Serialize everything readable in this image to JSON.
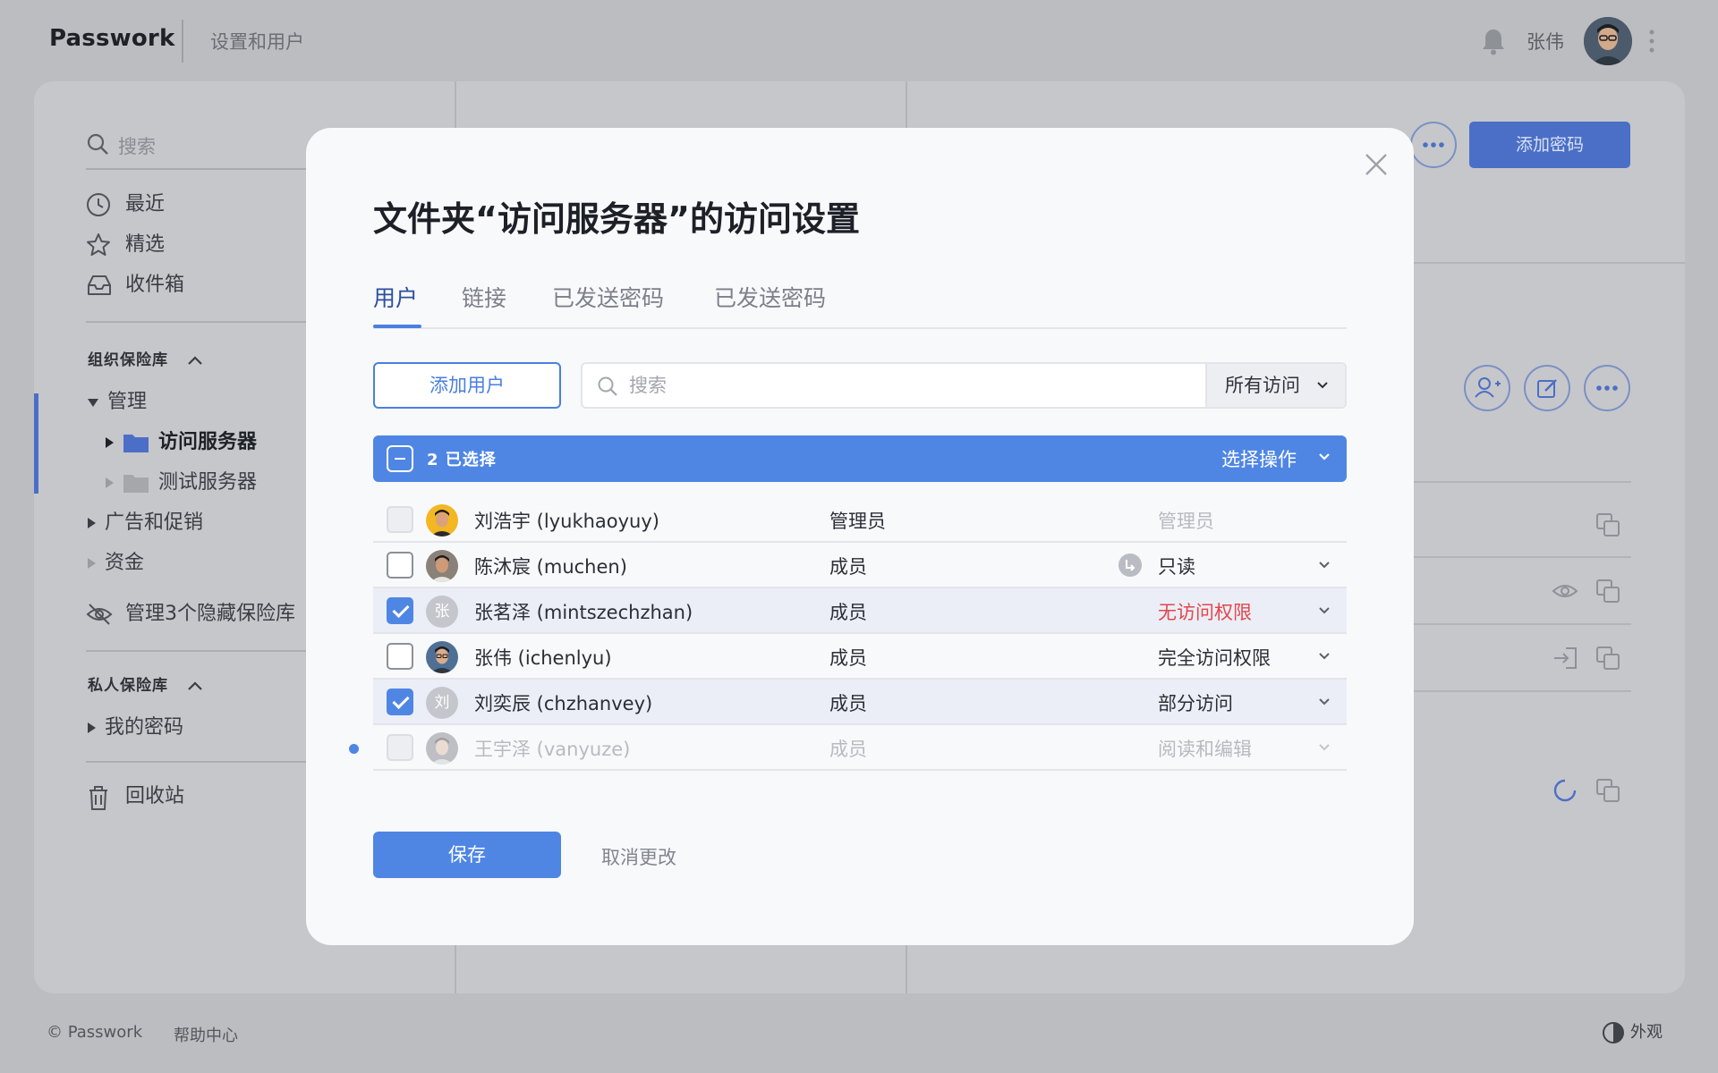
{
  "header": {
    "logo": "Passwork",
    "breadcrumb": "设置和用户",
    "user_name": "张伟"
  },
  "sidebar": {
    "search_placeholder": "搜索",
    "quick": [
      {
        "label": "最近",
        "icon": "clock-icon"
      },
      {
        "label": "精选",
        "icon": "star-icon"
      },
      {
        "label": "收件箱",
        "icon": "inbox-icon"
      }
    ],
    "org_vaults_title": "组织保险库",
    "tree": {
      "admin": "管理",
      "access_servers": "访问服务器",
      "test_servers": "测试服务器",
      "ads": "广告和促销",
      "funds": "资金"
    },
    "hidden_vaults": "管理3个隐藏保险库",
    "private_vaults_title": "私人保险库",
    "my_passwords": "我的密码",
    "trash": "回收站"
  },
  "background": {
    "add_password_label": "添加密码"
  },
  "footer": {
    "copyright": "© Passwork",
    "help": "帮助中心",
    "appearance": "外观"
  },
  "modal": {
    "title": "文件夹“访问服务器”的访问设置",
    "tabs": [
      "用户",
      "链接",
      "已发送密码",
      "已发送密码"
    ],
    "active_tab": 0,
    "add_user_label": "添加用户",
    "search_placeholder": "搜索",
    "filter_value": "所有访问",
    "selection_count": "2 已选择",
    "selection_action": "选择操作",
    "users": [
      {
        "name": "刘浩宇 (lyukhaoyuy)",
        "role": "管理员",
        "access": "管理员",
        "checked": false,
        "disabled": true,
        "avatar": "photo-yellow"
      },
      {
        "name": "陈沐宸 (muchen)",
        "role": "成员",
        "access": "只读",
        "checked": false,
        "disabled": false,
        "avatar": "photo-grey",
        "inherited": true
      },
      {
        "name": "张茗泽 (mintszechzhan)",
        "role": "成员",
        "access": "无访问权限",
        "checked": true,
        "disabled": false,
        "avatar": "letter",
        "avatar_letter": "张",
        "access_color": "#e0474c"
      },
      {
        "name": "张伟 (ichenlyu)",
        "role": "成员",
        "access": "完全访问权限",
        "checked": false,
        "disabled": false,
        "avatar": "photo-blue"
      },
      {
        "name": "刘奕辰 (chzhanvey)",
        "role": "成员",
        "access": "部分访问",
        "checked": true,
        "disabled": false,
        "avatar": "letter",
        "avatar_letter": "刘"
      },
      {
        "name": "王宇泽 (vanyuze)",
        "role": "成员",
        "access": "阅读和编辑",
        "checked": false,
        "disabled": true,
        "avatar": "photo-grey",
        "pending": true
      }
    ],
    "save_label": "保存",
    "cancel_label": "取消更改"
  },
  "colors": {
    "accent": "#4f86e4",
    "danger": "#e0474c"
  }
}
